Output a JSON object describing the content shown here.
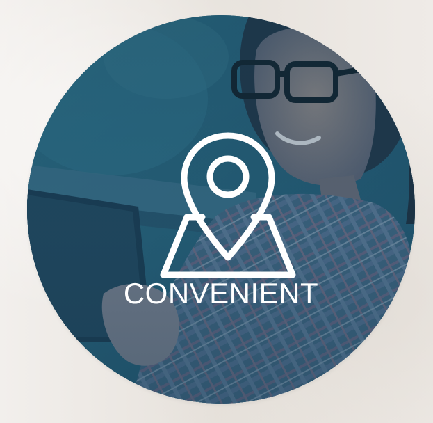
{
  "badge": {
    "label": "CONVENIENT",
    "icon": "map-pin-icon",
    "image": "woman-with-tablet-photo"
  },
  "colors": {
    "background": "#ece8e3",
    "overlay_blue": "#214f66",
    "label": "#ffffff"
  }
}
